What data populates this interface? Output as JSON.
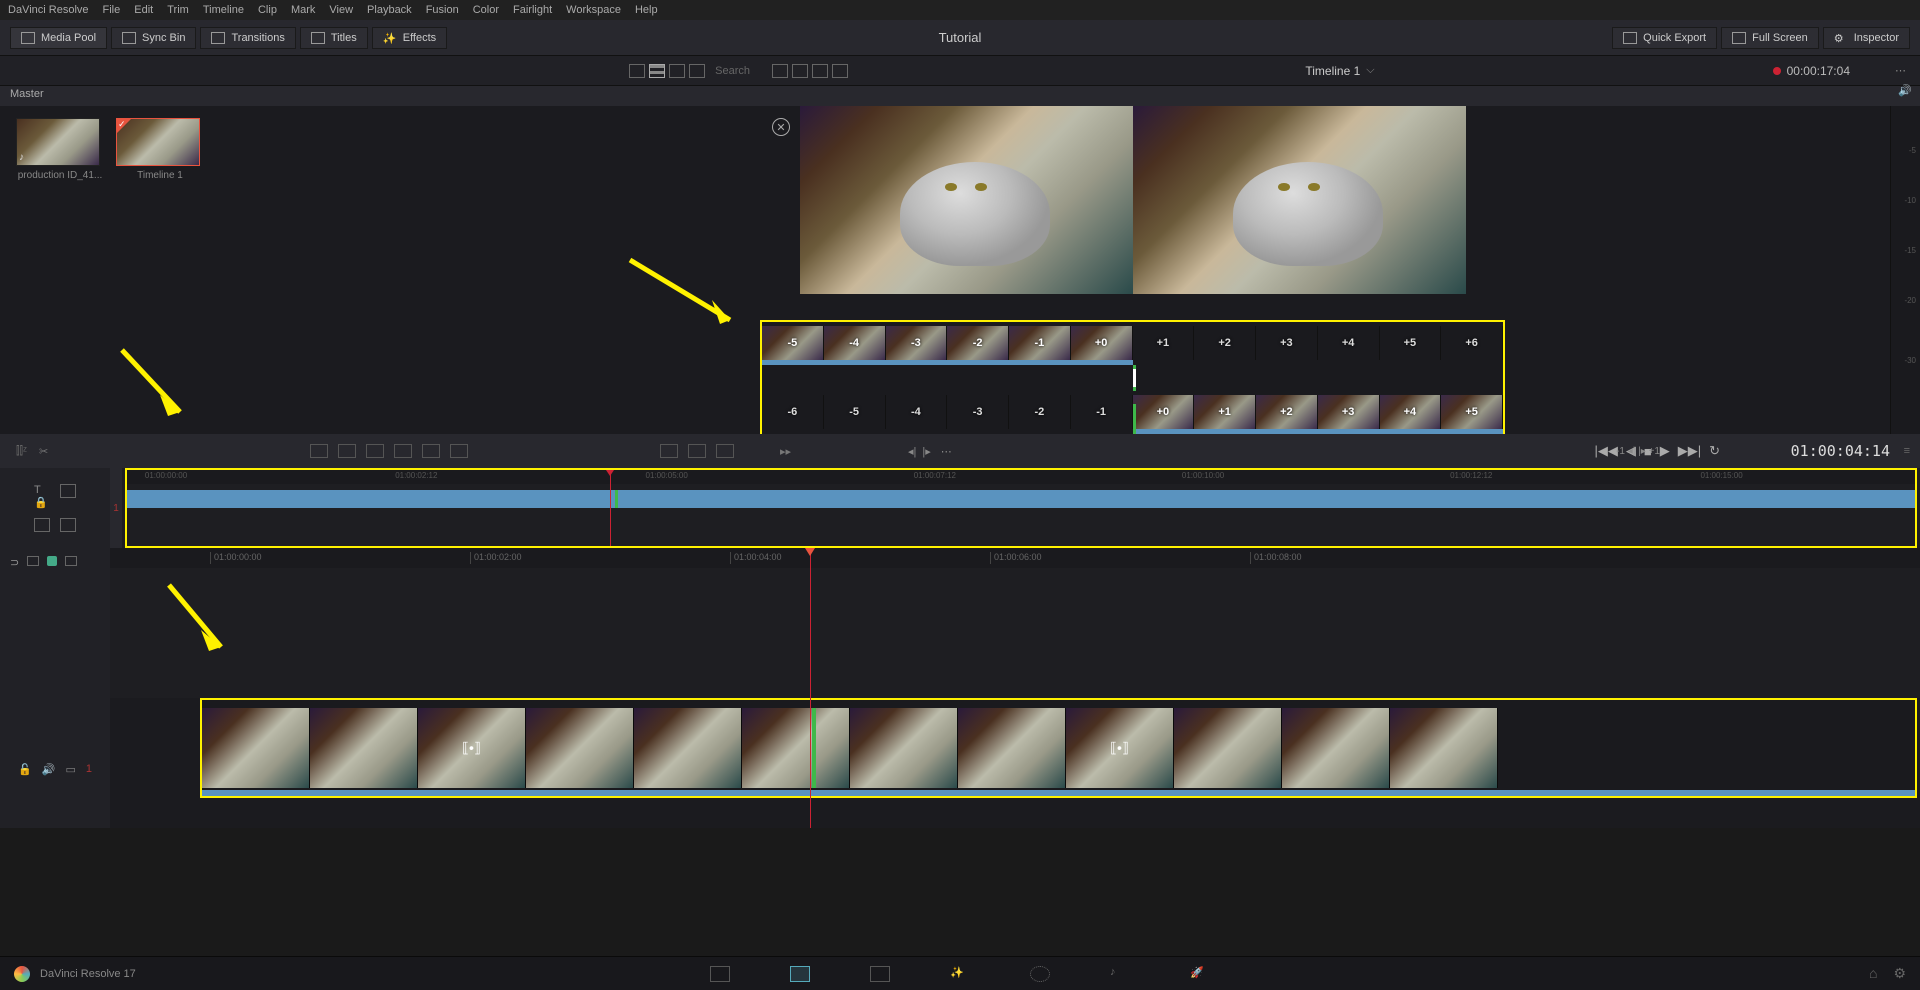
{
  "menubar": [
    "DaVinci Resolve",
    "File",
    "Edit",
    "Trim",
    "Timeline",
    "Clip",
    "Mark",
    "View",
    "Playback",
    "Fusion",
    "Color",
    "Fairlight",
    "Workspace",
    "Help"
  ],
  "toolbar": {
    "items": [
      {
        "label": "Media Pool"
      },
      {
        "label": "Sync Bin"
      },
      {
        "label": "Transitions"
      },
      {
        "label": "Titles"
      },
      {
        "label": "Effects"
      }
    ],
    "title": "Tutorial",
    "right": [
      {
        "label": "Quick Export"
      },
      {
        "label": "Full Screen"
      },
      {
        "label": "Inspector"
      }
    ]
  },
  "secondbar": {
    "search": "Search",
    "timeline": "Timeline 1",
    "timecode": "00:00:17:04"
  },
  "master": "Master",
  "thumbs": [
    {
      "label": "production ID_41..."
    },
    {
      "label": "Timeline 1"
    }
  ],
  "trim_top": [
    "-5",
    "-4",
    "-3",
    "-2",
    "-1",
    "+0",
    "+1",
    "+2",
    "+3",
    "+4",
    "+5",
    "+6"
  ],
  "trim_bot": [
    "-6",
    "-5",
    "-4",
    "-3",
    "-2",
    "-1",
    "+0",
    "+1",
    "+2",
    "+3",
    "+4",
    "+5"
  ],
  "transport": {
    "left": "-1",
    "right": "+1",
    "tc": "01:00:04:14"
  },
  "overview_ruler": [
    "01:00:00:00",
    "01:00:02:12",
    "01:00:05:00",
    "01:00:07:12",
    "01:00:10:00",
    "01:00:12:12",
    "01:00:15:00"
  ],
  "timeline_ruler": [
    "01:00:00:00",
    "01:00:02:00",
    "01:00:04:00",
    "01:00:06:00",
    "01:00:08:00"
  ],
  "meter_ticks": [
    "-5",
    "-10",
    "-15",
    "-20",
    "-30"
  ],
  "status": {
    "name": "DaVinci Resolve 17"
  },
  "track_num": "1"
}
